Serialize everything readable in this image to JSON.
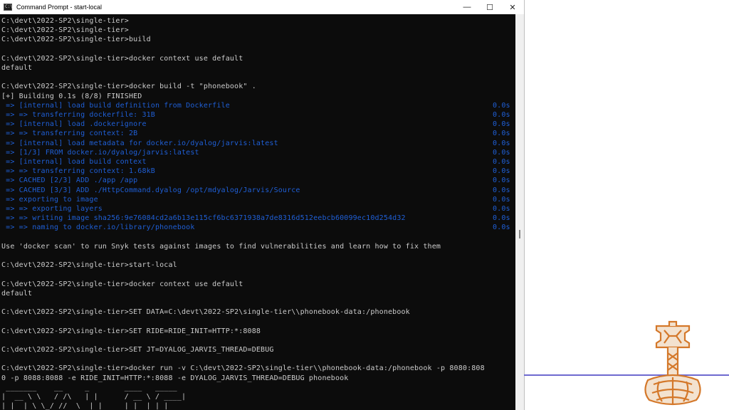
{
  "window": {
    "title": "Command Prompt - start-local",
    "controls": {
      "minimize": "—",
      "maximize": "☐",
      "close": "✕"
    }
  },
  "console": {
    "lines": [
      {
        "text": "C:\\devt\\2022-SP2\\single-tier>"
      },
      {
        "text": "C:\\devt\\2022-SP2\\single-tier>"
      },
      {
        "text": "C:\\devt\\2022-SP2\\single-tier>build"
      },
      {
        "text": ""
      },
      {
        "text": "C:\\devt\\2022-SP2\\single-tier>docker context use default"
      },
      {
        "text": "default"
      },
      {
        "text": ""
      },
      {
        "text": "C:\\devt\\2022-SP2\\single-tier>docker build -t \"phonebook\" ."
      },
      {
        "text": "[+] Building 0.1s (8/8) FINISHED"
      },
      {
        "text": " => [internal] load build definition from Dockerfile",
        "time": "0.0s",
        "style": "blue"
      },
      {
        "text": " => => transferring dockerfile: 31B",
        "time": "0.0s",
        "style": "blue"
      },
      {
        "text": " => [internal] load .dockerignore",
        "time": "0.0s",
        "style": "blue"
      },
      {
        "text": " => => transferring context: 2B",
        "time": "0.0s",
        "style": "blue"
      },
      {
        "text": " => [internal] load metadata for docker.io/dyalog/jarvis:latest",
        "time": "0.0s",
        "style": "blue"
      },
      {
        "text": " => [1/3] FROM docker.io/dyalog/jarvis:latest",
        "time": "0.0s",
        "style": "blue"
      },
      {
        "text": " => [internal] load build context",
        "time": "0.0s",
        "style": "blue"
      },
      {
        "text": " => => transferring context: 1.68kB",
        "time": "0.0s",
        "style": "blue"
      },
      {
        "text": " => CACHED [2/3] ADD ./app /app",
        "time": "0.0s",
        "style": "blue"
      },
      {
        "text": " => CACHED [3/3] ADD ./HttpCommand.dyalog /opt/mdyalog/Jarvis/Source",
        "time": "0.0s",
        "style": "blue"
      },
      {
        "text": " => exporting to image",
        "time": "0.0s",
        "style": "blue"
      },
      {
        "text": " => => exporting layers",
        "time": "0.0s",
        "style": "blue"
      },
      {
        "text": " => => writing image sha256:9e76084cd2a6b13e115cf6bc6371938a7de8316d512eebcb60099ec10d254d32",
        "time": "0.0s",
        "style": "blue"
      },
      {
        "text": " => => naming to docker.io/library/phonebook",
        "time": "0.0s",
        "style": "blue"
      },
      {
        "text": ""
      },
      {
        "text": "Use 'docker scan' to run Snyk tests against images to find vulnerabilities and learn how to fix them"
      },
      {
        "text": ""
      },
      {
        "text": "C:\\devt\\2022-SP2\\single-tier>start-local"
      },
      {
        "text": ""
      },
      {
        "text": "C:\\devt\\2022-SP2\\single-tier>docker context use default"
      },
      {
        "text": "default"
      },
      {
        "text": ""
      },
      {
        "text": "C:\\devt\\2022-SP2\\single-tier>SET DATA=C:\\devt\\2022-SP2\\single-tier\\\\phonebook-data:/phonebook"
      },
      {
        "text": ""
      },
      {
        "text": "C:\\devt\\2022-SP2\\single-tier>SET RIDE=RIDE_INIT=HTTP:*:8088"
      },
      {
        "text": ""
      },
      {
        "text": "C:\\devt\\2022-SP2\\single-tier>SET JT=DYALOG_JARVIS_THREAD=DEBUG"
      },
      {
        "text": ""
      },
      {
        "text": "C:\\devt\\2022-SP2\\single-tier>docker run -v C:\\devt\\2022-SP2\\single-tier\\\\phonebook-data:/phonebook -p 8080:808"
      },
      {
        "text": "0 -p 8088:8088 -e RIDE_INIT=HTTP:*:8088 -e DYALOG_JARVIS_THREAD=DEBUG phonebook"
      },
      {
        "text": " _______    __     _        ____   _____"
      },
      {
        "text": "|  __ \\ \\   / /\\   | |      / __ \\ / ____|"
      },
      {
        "text": "| |  | \\ \\_/ //  \\  | |     | |  | | |"
      }
    ]
  },
  "colors": {
    "console_bg": "#0c0c0c",
    "console_text": "#cccccc",
    "build_step_text": "#1f5fd6",
    "divider": "#6e6ad0",
    "logo_orange": "#d4782a"
  },
  "icons": {
    "app": "command-prompt-icon",
    "logo": "dyalog-hammer-logo"
  }
}
